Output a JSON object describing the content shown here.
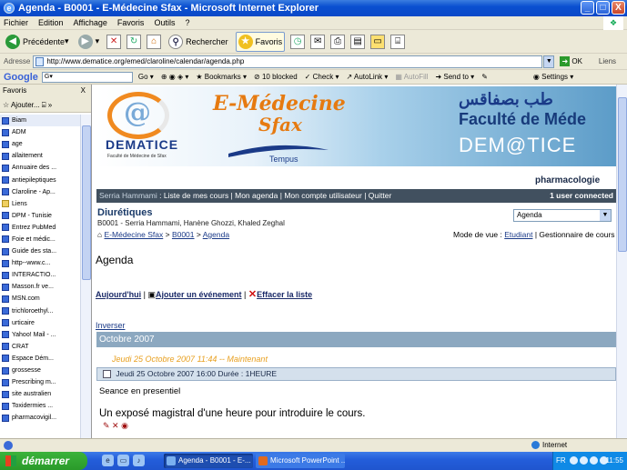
{
  "window": {
    "title": "Agenda - B0001 - E-Médecine Sfax - Microsoft Internet Explorer",
    "buttons": [
      "_",
      "□",
      "X"
    ]
  },
  "menu": [
    "Fichier",
    "Edition",
    "Affichage",
    "Favoris",
    "Outils",
    "?"
  ],
  "toolbar": {
    "back": "Précédente",
    "search": "Rechercher",
    "favorites": "Favoris"
  },
  "address": {
    "label": "Adresse",
    "url": "http://www.dematice.org/emed/claroline/calendar/agenda.php",
    "go": "OK",
    "links": "Liens"
  },
  "googlebar": {
    "logo": "Google",
    "go": "Go",
    "bookmarks": "Bookmarks",
    "blocked": "10 blocked",
    "check": "Check",
    "autolink": "AutoLink",
    "autofill": "AutoFill",
    "sendto": "Send to",
    "settings": "Settings"
  },
  "favorites": {
    "title": "Favoris",
    "close": "X",
    "add": "Ajouter...",
    "items": [
      {
        "label": "Biam",
        "folder": false
      },
      {
        "label": "ADM",
        "folder": false
      },
      {
        "label": "age",
        "folder": false
      },
      {
        "label": "allaitement",
        "folder": false
      },
      {
        "label": "Annuaire des ...",
        "folder": false
      },
      {
        "label": "antiepileptiques",
        "folder": false
      },
      {
        "label": "Claroline - Ap...",
        "folder": false
      },
      {
        "label": "Liens",
        "folder": true
      },
      {
        "label": "DPM - Tunisie",
        "folder": false
      },
      {
        "label": "Entrez PubMed",
        "folder": false
      },
      {
        "label": "Foie et médic...",
        "folder": false
      },
      {
        "label": "Guide des sta...",
        "folder": false
      },
      {
        "label": "http--www.c...",
        "folder": false
      },
      {
        "label": "INTERACTIO...",
        "folder": false
      },
      {
        "label": "Masson.fr ve...",
        "folder": false
      },
      {
        "label": "MSN.com",
        "folder": false
      },
      {
        "label": "trichloroethyl...",
        "folder": false
      },
      {
        "label": "urticaire",
        "folder": false
      },
      {
        "label": "Yahoo! Mail - ...",
        "folder": false
      },
      {
        "label": "CRAT",
        "folder": false
      },
      {
        "label": "Espace Dém...",
        "folder": false
      },
      {
        "label": "grossesse",
        "folder": false
      },
      {
        "label": "Prescribing m...",
        "folder": false
      },
      {
        "label": "site australien",
        "folder": false
      },
      {
        "label": "Toxidermies ...",
        "folder": false
      },
      {
        "label": "pharmacovigil...",
        "folder": false
      }
    ]
  },
  "banner": {
    "emed": "E-Médecine",
    "sfax": "Sfax",
    "dematice": "DEMATICE",
    "dematice_sub": "Faculté de Médecine de Sfax",
    "tempus": "Tempus",
    "arabic": "طب بصفاقس",
    "faculty": "Faculté de Méde",
    "dematice2": "DEM@TICE"
  },
  "course": {
    "category": "pharmacologie",
    "title": "Diurétiques",
    "description": "B0001 - Serria Hammami, Hanène Ghozzi, Khaled Zeghal"
  },
  "nav": {
    "user": "Serria Hammami",
    "links": "Liste de mes cours | Mon agenda | Mon compte utilisateur | Quitter",
    "online": "1 user connected"
  },
  "breadcrumb": {
    "home": "E-Médecine Sfax",
    "course": "B0001",
    "current": "Agenda"
  },
  "tool_select": "Agenda",
  "viewmode": {
    "label": "Mode de vue :",
    "student": "Etudiant",
    "manager": "Gestionnaire de cours"
  },
  "agenda": {
    "heading": "Agenda",
    "today": "Aujourd'hui",
    "add_event": "Ajouter un événement",
    "clear": "Effacer la liste",
    "invert": "Inverser",
    "month": "Octobre 2007",
    "now_line": "Jeudi 25 Octobre 2007 11:44 -- Maintenant",
    "event_date": "Jeudi 25 Octobre 2007 16:00 Durée : 1HEURE",
    "event_title": "Seance en presentiel",
    "event_desc": "Un exposé magistral d'une heure pour introduire le cours."
  },
  "status": {
    "zone": "Internet"
  },
  "taskbar": {
    "start": "démarrer",
    "task1": "Agenda - B0001 - E-...",
    "task2": "Microsoft PowerPoint ...",
    "lang": "FR",
    "time": "11:55"
  }
}
